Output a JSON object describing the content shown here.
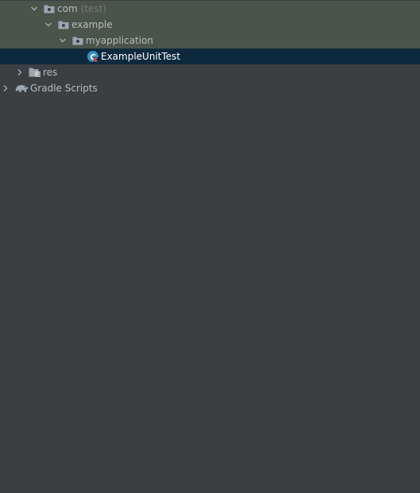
{
  "tree": {
    "items": [
      {
        "label": "com",
        "suffix": "(test)",
        "icon": "package-folder-icon",
        "expanded": true
      },
      {
        "label": "example",
        "suffix": "",
        "icon": "package-folder-icon",
        "expanded": true
      },
      {
        "label": "myapplication",
        "suffix": "",
        "icon": "package-folder-icon",
        "expanded": true
      },
      {
        "label": "ExampleUnitTest",
        "suffix": "",
        "icon": "kotlin-test-class-icon",
        "selected": true
      },
      {
        "label": "res",
        "suffix": "",
        "icon": "resource-folder-icon",
        "expanded": false
      },
      {
        "label": "Gradle Scripts",
        "suffix": "",
        "icon": "gradle-elephant-icon",
        "expanded": false
      }
    ]
  },
  "colors": {
    "background": "#3c3f41",
    "test_row_background": "#49544a",
    "selection_background": "#0d293e",
    "text": "#bbbbbb",
    "dim_text": "#787878"
  }
}
